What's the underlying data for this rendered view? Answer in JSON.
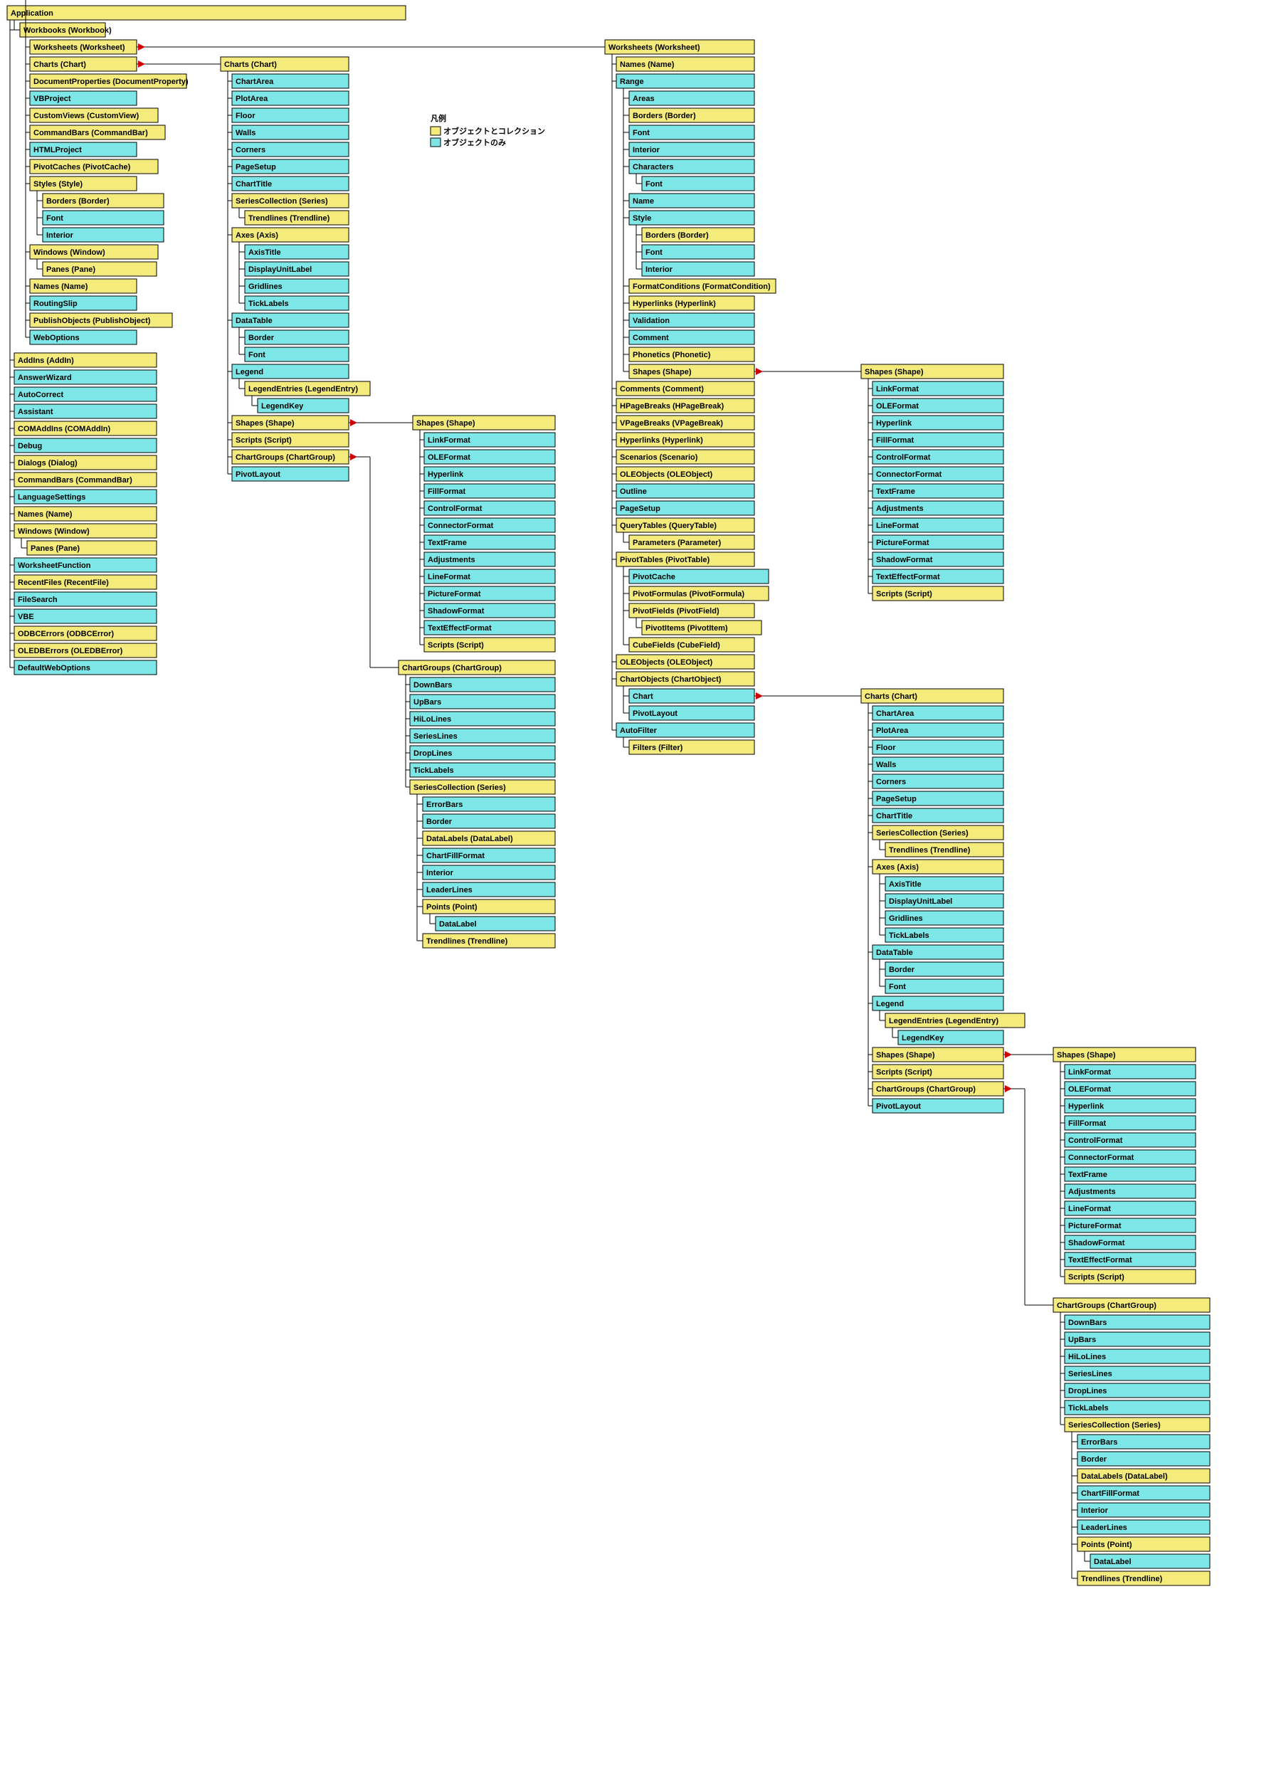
{
  "legend": {
    "title": "凡例",
    "collection": "オブジェクトとコレクション",
    "object": "オブジェクトのみ"
  },
  "root": "Application",
  "workbooks": "Workbooks (Workbook)",
  "col1": {
    "worksheets": "Worksheets (Worksheet)",
    "charts": "Charts (Chart)",
    "docProps": "DocumentProperties (DocumentProperty)",
    "vbproject": "VBProject",
    "customViews": "CustomViews (CustomView)",
    "commandBars": "CommandBars (CommandBar)",
    "htmlProject": "HTMLProject",
    "pivotCaches": "PivotCaches (PivotCache)",
    "styles": "Styles (Style)",
    "borders": "Borders (Border)",
    "font": "Font",
    "interior": "Interior",
    "windows": "Windows (Window)",
    "panes": "Panes (Pane)",
    "names": "Names (Name)",
    "routingSlip": "RoutingSlip",
    "publishObjects": "PublishObjects (PublishObject)",
    "webOptions": "WebOptions"
  },
  "appChildren": [
    "AddIns (AddIn)",
    "AnswerWizard",
    "AutoCorrect",
    "Assistant",
    "COMAddIns (COMAddIn)",
    "Debug",
    "Dialogs (Dialog)",
    "CommandBars (CommandBar)",
    "LanguageSettings",
    "Names (Name)",
    "Windows (Window)"
  ],
  "appWindowsPanes": "Panes (Pane)",
  "appChildren2": [
    "WorksheetFunction",
    "RecentFiles (RecentFile)",
    "FileSearch",
    "VBE",
    "ODBCErrors (ODBCError)",
    "OLEDBErrors (OLEDBError)",
    "DefaultWebOptions"
  ],
  "chartsTree": {
    "root": "Charts (Chart)",
    "simple": [
      "ChartArea",
      "PlotArea",
      "Floor",
      "Walls",
      "Corners",
      "PageSetup",
      "ChartTitle"
    ],
    "series": "SeriesCollection (Series)",
    "trendlines": "Trendlines (Trendline)",
    "axes": "Axes (Axis)",
    "axesChildren": [
      "AxisTitle",
      "DisplayUnitLabel",
      "Gridlines",
      "TickLabels"
    ],
    "dataTable": "DataTable",
    "dataTableChildren": [
      "Border",
      "Font"
    ],
    "legend": "Legend",
    "legendEntries": "LegendEntries (LegendEntry)",
    "legendKey": "LegendKey",
    "shapes": "Shapes (Shape)",
    "scripts": "Scripts (Script)",
    "chartGroups": "ChartGroups (ChartGroup)",
    "pivotLayout": "PivotLayout"
  },
  "shapesTree": {
    "root": "Shapes (Shape)",
    "children": [
      "LinkFormat",
      "OLEFormat",
      "Hyperlink",
      "FillFormat",
      "ControlFormat",
      "ConnectorFormat",
      "TextFrame",
      "Adjustments",
      "LineFormat",
      "PictureFormat",
      "ShadowFormat",
      "TextEffectFormat"
    ],
    "scripts": "Scripts (Script)"
  },
  "chartGroups": {
    "root": "ChartGroups (ChartGroup)",
    "children": [
      "DownBars",
      "UpBars",
      "HiLoLines",
      "SeriesLines",
      "DropLines",
      "TickLabels"
    ],
    "series": "SeriesCollection (Series)",
    "seriesChildren": [
      "ErrorBars",
      "Border"
    ],
    "dataLabels": "DataLabels (DataLabel)",
    "seriesChildren2": [
      "ChartFillFormat",
      "Interior",
      "LeaderLines"
    ],
    "points": "Points (Point)",
    "dataLabel": "DataLabel",
    "trendlines": "Trendlines (Trendline)"
  },
  "ws": {
    "root": "Worksheets (Worksheet)",
    "names": "Names (Name)",
    "range": "Range",
    "rangeChildren1": [
      "Areas",
      "Borders (Border)",
      "Font",
      "Interior"
    ],
    "characters": "Characters",
    "charFont": "Font",
    "name": "Name",
    "style": "Style",
    "styleChildren": [
      "Borders (Border)",
      "Font",
      "Interior"
    ],
    "fc": "FormatConditions (FormatCondition)",
    "hyperlinks": "Hyperlinks (Hyperlink)",
    "validation": "Validation",
    "comment": "Comment",
    "phonetics": "Phonetics (Phonetic)",
    "shapes": "Shapes (Shape)",
    "after": [
      "Comments (Comment)",
      "HPageBreaks (HPageBreak)",
      "VPageBreaks (VPageBreak)",
      "Hyperlinks (Hyperlink)",
      "Scenarios (Scenario)",
      "OLEObjects (OLEObject)"
    ],
    "outline": "Outline",
    "pageSetup": "PageSetup",
    "queryTables": "QueryTables (QueryTable)",
    "parameters": "Parameters (Parameter)",
    "pivotTables": "PivotTables (PivotTable)",
    "ptChildren": [
      "PivotCache",
      "PivotFormulas (PivotFormula)"
    ],
    "pivotFields": "PivotFields (PivotField)",
    "pivotItems": "PivotItems (PivotItem)",
    "cubeFields": "CubeFields (CubeField)",
    "oleObjects": "OLEObjects (OLEObject)",
    "chartObjects": "ChartObjects (ChartObject)",
    "chart": "Chart",
    "pivotLayout": "PivotLayout",
    "autoFilter": "AutoFilter",
    "filters": "Filters (Filter)"
  },
  "rShapes": {
    "root": "Shapes (Shape)",
    "children": [
      "LinkFormat",
      "OLEFormat",
      "Hyperlink",
      "FillFormat",
      "ControlFormat",
      "ConnectorFormat",
      "TextFrame",
      "Adjustments",
      "LineFormat",
      "PictureFormat",
      "ShadowFormat",
      "TextEffectFormat"
    ],
    "scripts": "Scripts (Script)"
  },
  "rChart": {
    "root": "Charts (Chart)",
    "simple": [
      "ChartArea",
      "PlotArea",
      "Floor",
      "Walls",
      "Corners",
      "PageSetup",
      "ChartTitle"
    ],
    "series": "SeriesCollection (Series)",
    "trendlines": "Trendlines (Trendline)",
    "axes": "Axes (Axis)",
    "axesChildren": [
      "AxisTitle",
      "DisplayUnitLabel",
      "Gridlines",
      "TickLabels"
    ],
    "dataTable": "DataTable",
    "dataTableChildren": [
      "Border",
      "Font"
    ],
    "legend": "Legend",
    "legendEntries": "LegendEntries (LegendEntry)",
    "legendKey": "LegendKey",
    "shapes": "Shapes (Shape)",
    "scripts": "Scripts (Script)",
    "chartGroups": "ChartGroups (ChartGroup)",
    "pivotLayout": "PivotLayout"
  }
}
